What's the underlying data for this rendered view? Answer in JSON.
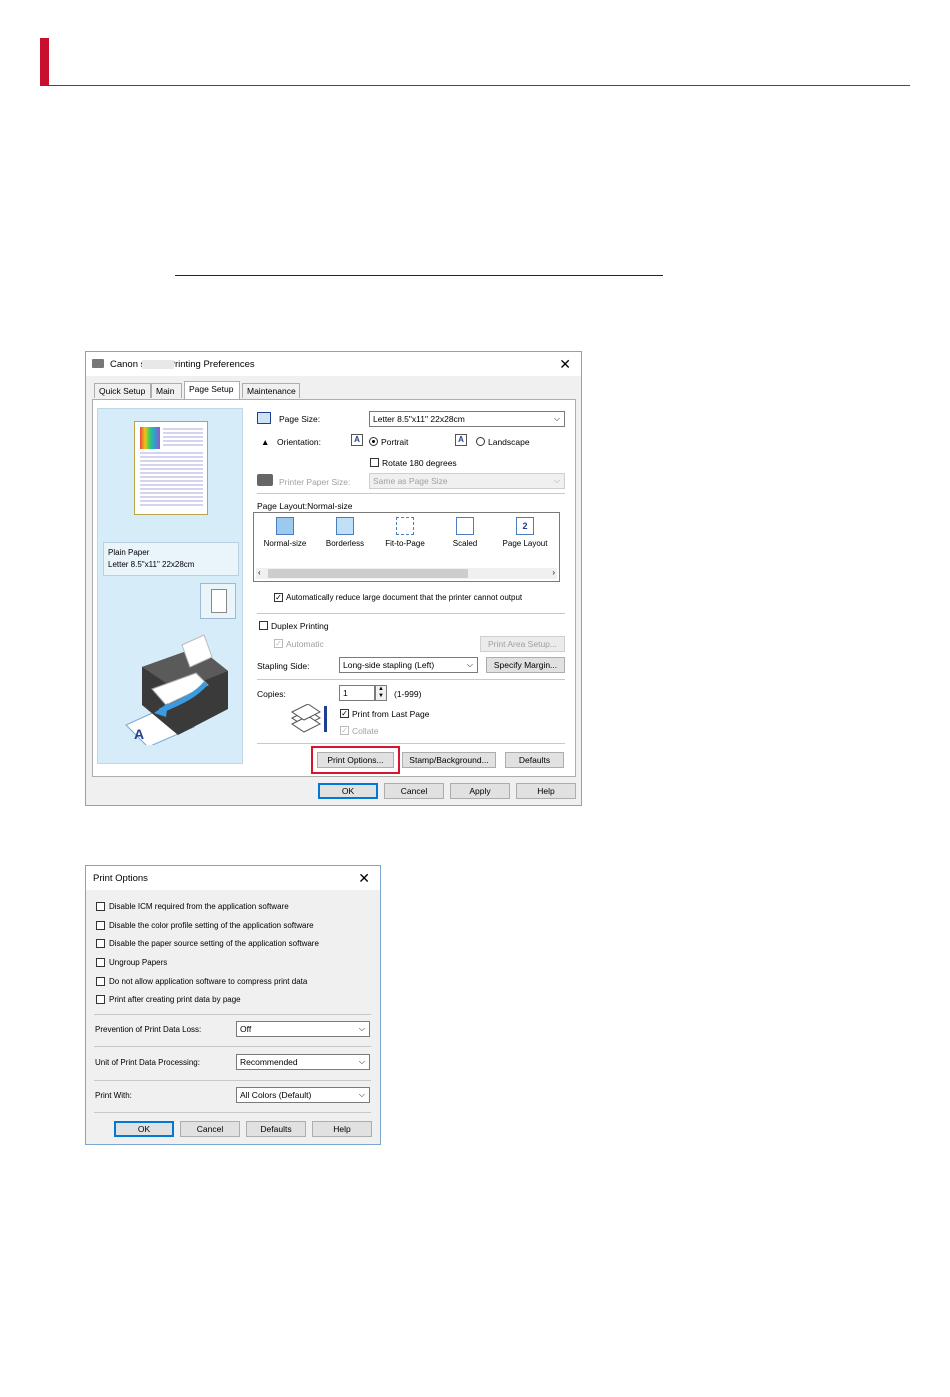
{
  "dialog1": {
    "title": "Canon          series Printing Preferences",
    "close": "✕",
    "tabs": [
      "Quick Setup",
      "Main",
      "Page Setup",
      "Maintenance"
    ],
    "preview": {
      "paper_type": "Plain Paper",
      "paper_size": "Letter 8.5\"x11\" 22x28cm"
    },
    "page_size": {
      "label": "Page Size:",
      "value": "Letter 8.5\"x11\" 22x28cm"
    },
    "orientation": {
      "label": "Orientation:",
      "portrait": "Portrait",
      "landscape": "Landscape"
    },
    "rotate": "Rotate 180 degrees",
    "printer_paper_size": {
      "label": "Printer Paper Size:",
      "value": "Same as Page Size"
    },
    "page_layout": {
      "label": "Page Layout:Normal-size",
      "items": [
        "Normal-size",
        "Borderless",
        "Fit-to-Page",
        "Scaled",
        "Page Layout"
      ]
    },
    "auto_reduce": "Automatically reduce large document that the printer cannot output",
    "duplex": "Duplex Printing",
    "automatic": "Automatic",
    "print_area_setup": "Print Area Setup...",
    "stapling_side": {
      "label": "Stapling Side:",
      "value": "Long-side stapling (Left)"
    },
    "specify_margin": "Specify Margin...",
    "copies": {
      "label": "Copies:",
      "value": "1",
      "range": "(1-999)"
    },
    "print_from_last_page": "Print from Last Page",
    "collate": "Collate",
    "print_options": "Print Options...",
    "stamp_background": "Stamp/Background...",
    "defaults": "Defaults",
    "ok": "OK",
    "cancel": "Cancel",
    "apply": "Apply",
    "help": "Help"
  },
  "dialog2": {
    "title": "Print Options",
    "close": "✕",
    "checkboxes": [
      "Disable ICM required from the application software",
      "Disable the color profile setting of the application software",
      "Disable the paper source setting of the application software",
      "Ungroup Papers",
      "Do not allow application software to compress print data",
      "Print after creating print data by page"
    ],
    "prevention": {
      "label": "Prevention of Print Data Loss:",
      "value": "Off"
    },
    "unit": {
      "label": "Unit of Print Data Processing:",
      "value": "Recommended"
    },
    "print_with": {
      "label": "Print With:",
      "value": "All Colors (Default)"
    },
    "ok": "OK",
    "cancel": "Cancel",
    "defaults": "Defaults",
    "help": "Help"
  },
  "colors": {
    "accent_red": "#c8102e",
    "highlight": "#d8152e",
    "preview_bg": "#d6ecf9"
  }
}
